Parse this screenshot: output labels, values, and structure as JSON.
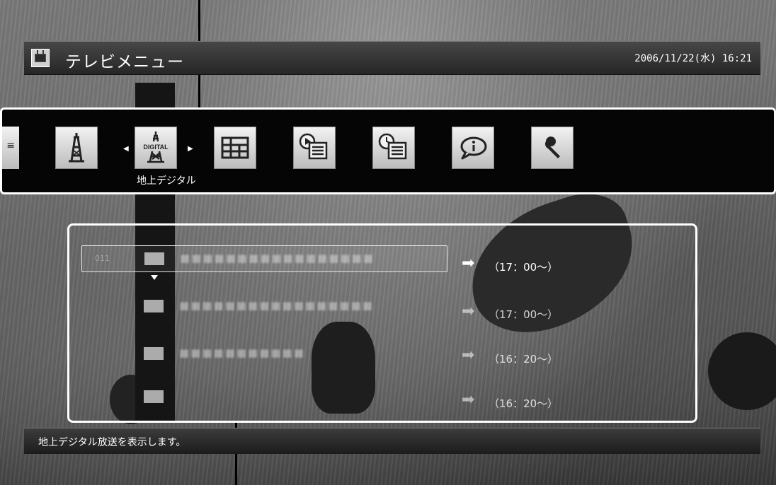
{
  "header": {
    "title": "テレビメニュー",
    "datetime": "2006/11/22(水) 16:21"
  },
  "menu": {
    "selected_label": "地上デジタル",
    "items": [
      {
        "icon": "list-icon"
      },
      {
        "icon": "antenna-tower-icon"
      },
      {
        "icon": "digital-antenna-icon",
        "badge": "DIGITAL"
      },
      {
        "icon": "program-guide-icon"
      },
      {
        "icon": "recorded-playback-icon"
      },
      {
        "icon": "timer-record-icon"
      },
      {
        "icon": "info-icon"
      },
      {
        "icon": "settings-wrench-icon"
      }
    ]
  },
  "channels": [
    {
      "time": "（17：00～）"
    },
    {
      "time": "（17：00～）"
    },
    {
      "time": "（16：20～）"
    },
    {
      "time": "（16：20～）"
    }
  ],
  "status": {
    "message": "地上デジタル放送を表示します。"
  }
}
